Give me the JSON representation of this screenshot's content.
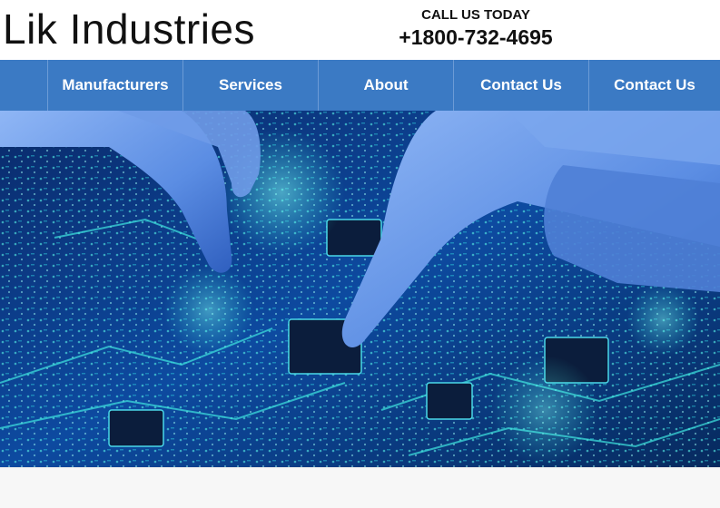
{
  "brand": {
    "name": "Lik Industries"
  },
  "contact": {
    "label": "CALL US TODAY",
    "phone": "+1800-732-4695"
  },
  "nav": {
    "items": [
      {
        "label": "Manufacturers"
      },
      {
        "label": "Services"
      },
      {
        "label": "About"
      },
      {
        "label": "Contact Us"
      },
      {
        "label": "Contact Us"
      }
    ]
  },
  "colors": {
    "nav_background": "#3b7ac4",
    "nav_divider": "#6c9bd6",
    "hero_base": "#071c40",
    "circuit_glow": "#38e8e0",
    "glove": "#5b8de3"
  },
  "hero": {
    "icon": "circuit-board-image"
  }
}
